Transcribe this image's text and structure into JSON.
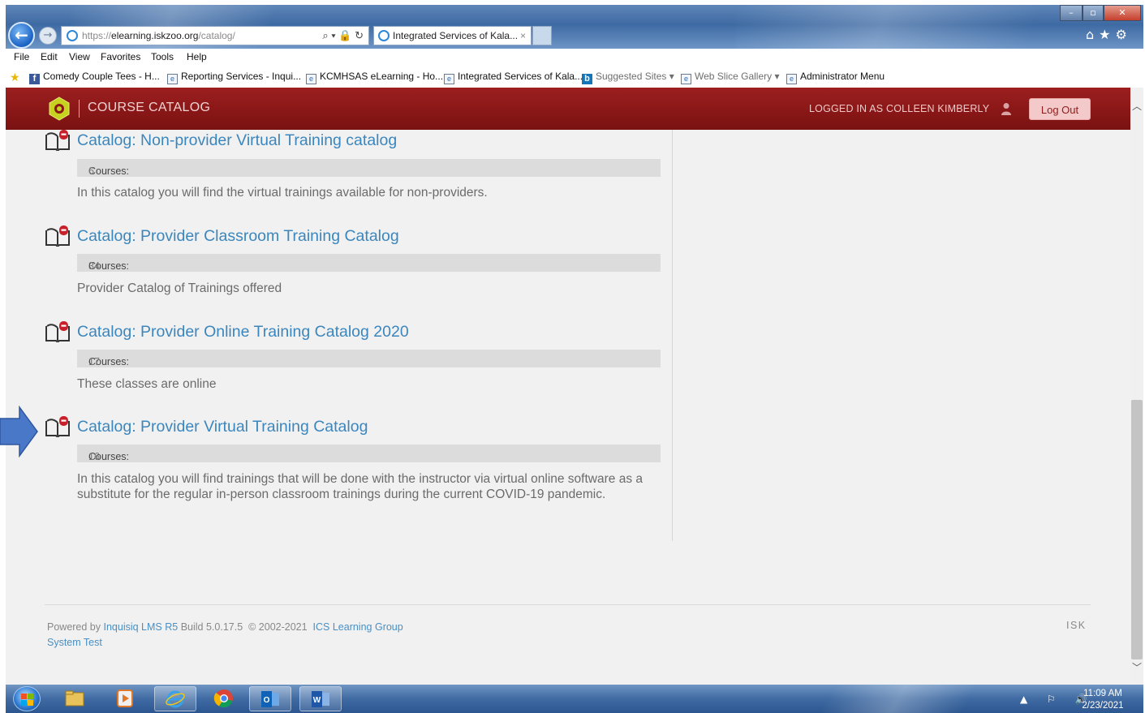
{
  "browser": {
    "address": {
      "prefix": "https://",
      "host": "elearning.iskzoo.org",
      "path": "/catalog/"
    },
    "address_tools": "⌕ ▾ 🔒 ↻",
    "tab_label": "Integrated Services of Kala...",
    "tab_close": "×",
    "window_controls": {
      "minimize": "–",
      "maximize": "▫",
      "close": "✕"
    },
    "right_tools": "⌂★⚙"
  },
  "menubar": [
    "File",
    "Edit",
    "View",
    "Favorites",
    "Tools",
    "Help"
  ],
  "favorites": [
    {
      "label": "Comedy Couple Tees - H...",
      "icon": "facebook-icon"
    },
    {
      "label": "Reporting Services - Inqui...",
      "icon": "ie-page-icon"
    },
    {
      "label": "KCMHSAS eLearning - Ho...",
      "icon": "ie-page-icon"
    },
    {
      "label": "Integrated Services of Kala...",
      "icon": "ie-page-icon"
    },
    {
      "label": "Suggested Sites ▾",
      "icon": "bing-icon"
    },
    {
      "label": "Web Slice Gallery ▾",
      "icon": "ie-page-icon"
    },
    {
      "label": "Administrator Menu",
      "icon": "ie-page-icon"
    }
  ],
  "app": {
    "title": "COURSE CATALOG",
    "logged_in": "LOGGED IN AS COLLEEN KIMBERLY",
    "logout": "Log Out",
    "brand_color": "#8a1717"
  },
  "catalogs": [
    {
      "title": "Catalog: Non-provider Virtual Training catalog",
      "courses_label": "Courses:",
      "courses_count": "6",
      "description": "In this catalog you will find the virtual trainings available for non-providers."
    },
    {
      "title": "Catalog: Provider Classroom Training Catalog",
      "courses_label": "Courses:",
      "courses_count": "34",
      "description": "Provider Catalog of Trainings offered"
    },
    {
      "title": "Catalog: Provider Online Training Catalog 2020",
      "courses_label": "Courses:",
      "courses_count": "17",
      "description": "These classes are online"
    },
    {
      "title": "Catalog: Provider Virtual Training Catalog",
      "courses_label": "Courses:",
      "courses_count": "16",
      "description": "In this catalog you will find trainings that will be done with the instructor via virtual online software as a substitute for the regular in-person classroom trainings during the current COVID-19 pandemic."
    }
  ],
  "footer": {
    "powered_by": "Powered by",
    "lms_link": "Inquisiq LMS R5",
    "build": "Build 5.0.17.5",
    "copyright": "© 2002-2021",
    "company_link": "ICS Learning Group",
    "system_test": "System Test",
    "right_code": "ISK"
  },
  "taskbar": {
    "time": "11:09 AM",
    "date": "2/23/2021",
    "tray_icons": "▲ ⚐ 🔊"
  }
}
